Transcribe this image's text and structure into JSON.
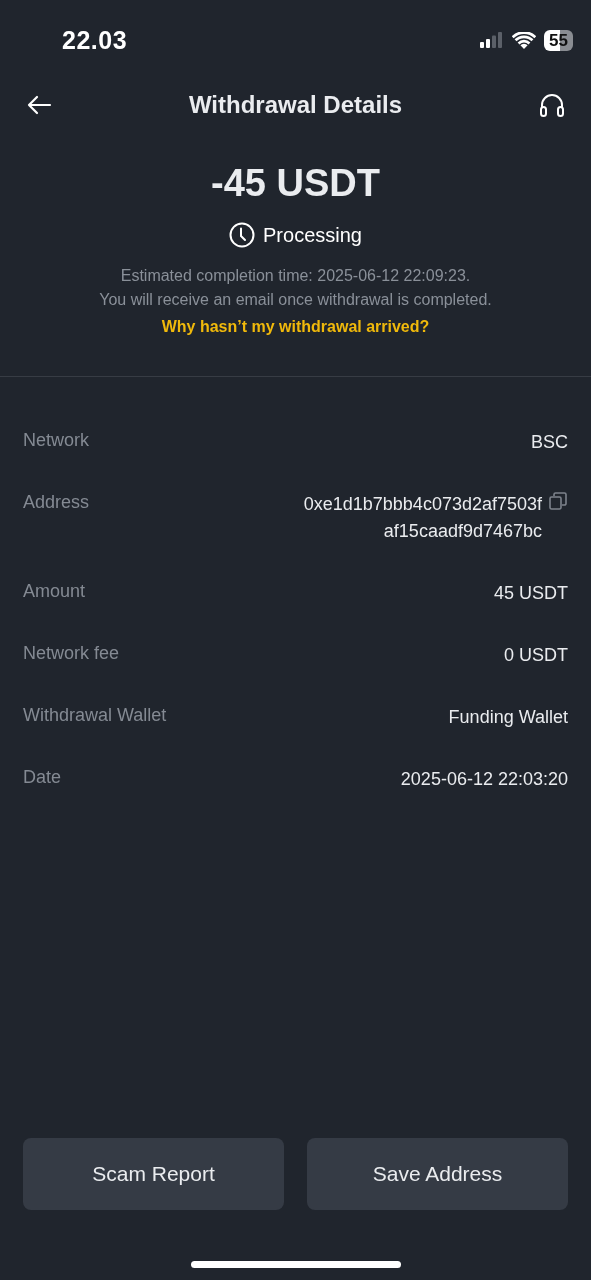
{
  "status_bar": {
    "time": "22.03",
    "battery": "55"
  },
  "header": {
    "title": "Withdrawal Details"
  },
  "summary": {
    "amount": "-45 USDT",
    "status": "Processing",
    "note_lines": [
      "Estimated completion time: 2025-06-12 22:09:23.",
      "You will receive an email once withdrawal is completed."
    ],
    "help_link": "Why hasn’t my withdrawal arrived?"
  },
  "details": [
    {
      "label": "Network",
      "value": [
        "BSC"
      ],
      "copyable": false
    },
    {
      "label": "Address",
      "value": [
        "0xe1d1b7bbb4c073d2af7503f",
        "af15caadf9d7467bc"
      ],
      "copyable": true
    },
    {
      "label": "Amount",
      "value": [
        "45 USDT"
      ],
      "copyable": false
    },
    {
      "label": "Network fee",
      "value": [
        "0 USDT"
      ],
      "copyable": false
    },
    {
      "label": "Withdrawal Wallet",
      "value": [
        "Funding Wallet"
      ],
      "copyable": false
    },
    {
      "label": "Date",
      "value": [
        "2025-06-12 22:03:20"
      ],
      "copyable": false
    }
  ],
  "buttons": [
    "Scam Report",
    "Save Address"
  ]
}
